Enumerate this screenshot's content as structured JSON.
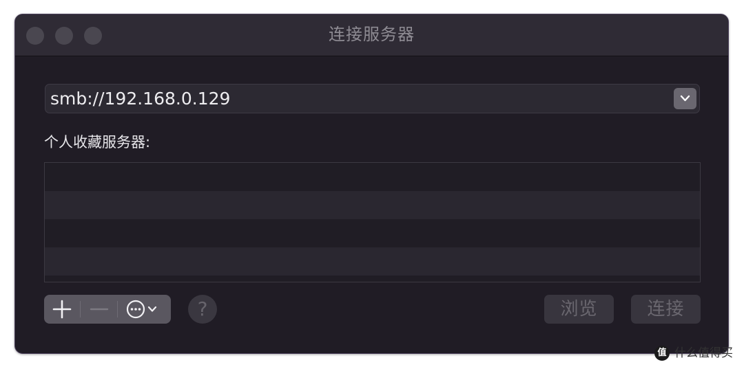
{
  "window": {
    "title": "连接服务器"
  },
  "server": {
    "address": "smb://192.168.0.129",
    "dropdown_icon": "chevron-down-icon"
  },
  "favorites": {
    "label": "个人收藏服务器:",
    "rows": [
      "",
      "",
      "",
      ""
    ]
  },
  "toolbar": {
    "add_icon": "plus-icon",
    "remove_icon": "minus-icon",
    "more_icon": "ellipsis-circle-icon",
    "help_label": "?"
  },
  "buttons": {
    "browse": "浏览",
    "connect": "连接"
  },
  "watermark": {
    "logo_text": "值",
    "text": "什么值得买"
  },
  "colors": {
    "window_bg": "#201c25",
    "titlebar_bg": "#2f2b35",
    "accent_border": "#4a3f5a"
  }
}
